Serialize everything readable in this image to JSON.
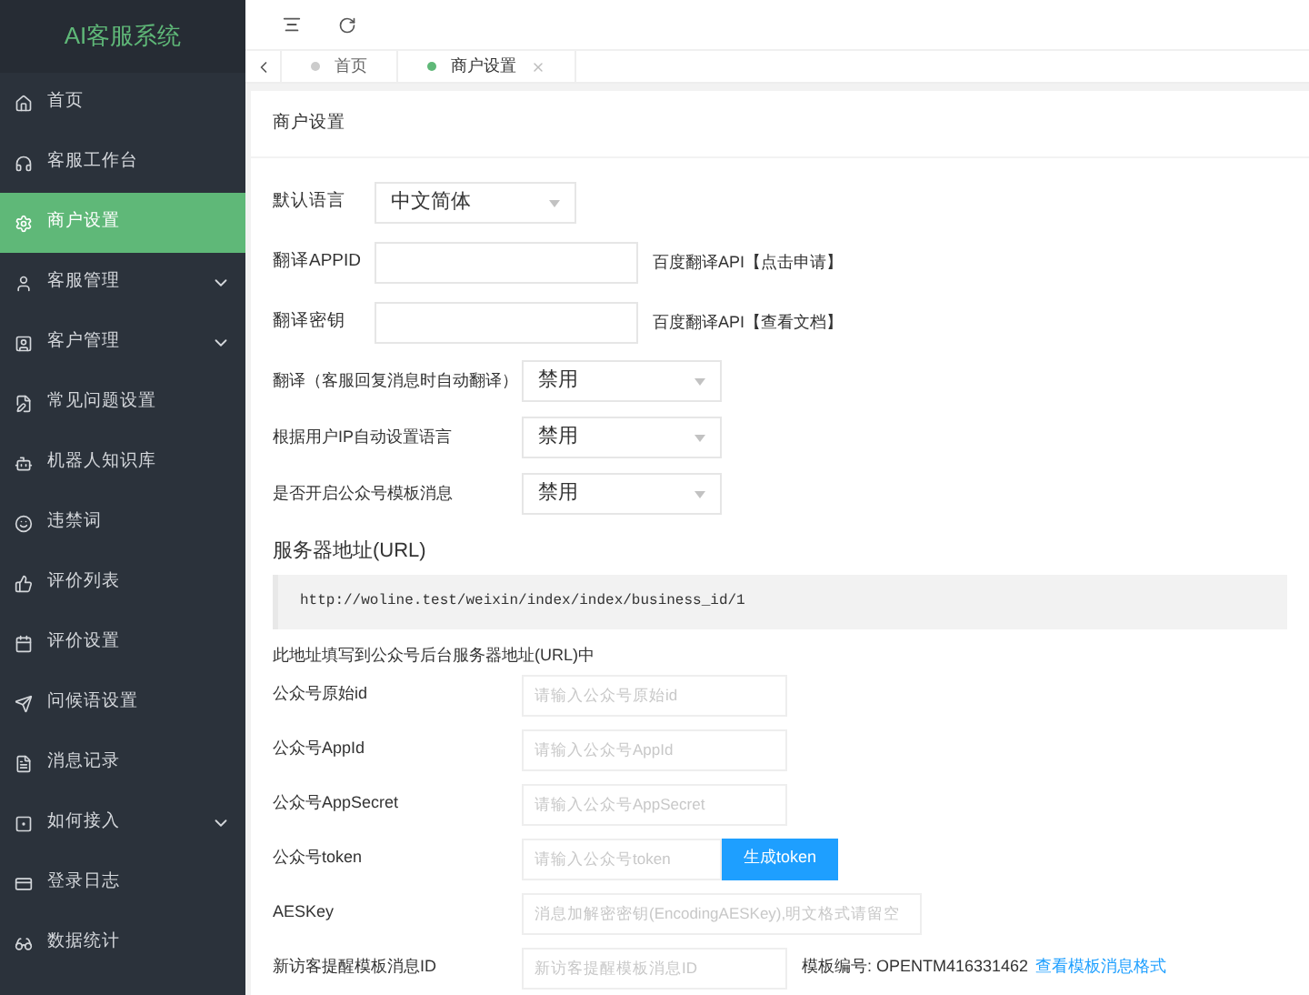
{
  "sidebar": {
    "title": "AI客服系统",
    "items": [
      {
        "label": "首页",
        "selected": false,
        "has_submenu": false
      },
      {
        "label": "客服工作台",
        "selected": false,
        "has_submenu": false
      },
      {
        "label": "商户设置",
        "selected": true,
        "has_submenu": false
      },
      {
        "label": "客服管理",
        "selected": false,
        "has_submenu": true
      },
      {
        "label": "客户管理",
        "selected": false,
        "has_submenu": true
      },
      {
        "label": "常见问题设置",
        "selected": false,
        "has_submenu": false
      },
      {
        "label": "机器人知识库",
        "selected": false,
        "has_submenu": false
      },
      {
        "label": "违禁词",
        "selected": false,
        "has_submenu": false
      },
      {
        "label": "评价列表",
        "selected": false,
        "has_submenu": false
      },
      {
        "label": "评价设置",
        "selected": false,
        "has_submenu": false
      },
      {
        "label": "问候语设置",
        "selected": false,
        "has_submenu": false
      },
      {
        "label": "消息记录",
        "selected": false,
        "has_submenu": false
      },
      {
        "label": "如何接入",
        "selected": false,
        "has_submenu": true
      },
      {
        "label": "登录日志",
        "selected": false,
        "has_submenu": false
      },
      {
        "label": "数据统计",
        "selected": false,
        "has_submenu": false
      }
    ]
  },
  "tabs": [
    {
      "label": "首页",
      "selected": false,
      "closable": false
    },
    {
      "label": "商户设置",
      "selected": true,
      "closable": true
    }
  ],
  "panel": {
    "title": "商户设置",
    "basic_settings": [
      {
        "kind": "select",
        "label": "默认语言",
        "value": "中文简体"
      },
      {
        "kind": "input",
        "label": "翻译APPID",
        "note": "百度翻译API【点击申请】"
      },
      {
        "kind": "input",
        "label": "翻译密钥",
        "note": "百度翻译API【查看文档】"
      }
    ],
    "switch_settings": [
      {
        "label": "翻译（客服回复消息时自动翻译）",
        "value": "禁用"
      },
      {
        "label": "根据用户IP自动设置语言",
        "value": "禁用"
      },
      {
        "label": "是否开启公众号模板消息",
        "value": "禁用"
      }
    ],
    "server_url": {
      "heading": "服务器地址(URL)",
      "url": "http://woline.test/weixin/index/index/business_id/1",
      "hint": "此地址填写到公众号后台服务器地址(URL)中"
    },
    "wechat_settings": [
      {
        "label": "公众号原始id",
        "placeholder": "请输入公众号原始id"
      },
      {
        "label": "公众号AppId",
        "placeholder": "请输入公众号AppId"
      },
      {
        "label": "公众号AppSecret",
        "placeholder": "请输入公众号AppSecret"
      },
      {
        "label": "公众号token",
        "placeholder": "请输入公众号token",
        "button": "生成token"
      },
      {
        "label": "AESKey",
        "placeholder": "消息加解密密钥(EncodingAESKey),明文格式请留空"
      },
      {
        "label": "新访客提醒模板消息ID",
        "placeholder": "新访客提醒模板消息ID",
        "note": "模板编号: OPENTM416331462",
        "link": "查看模板消息格式"
      }
    ]
  }
}
